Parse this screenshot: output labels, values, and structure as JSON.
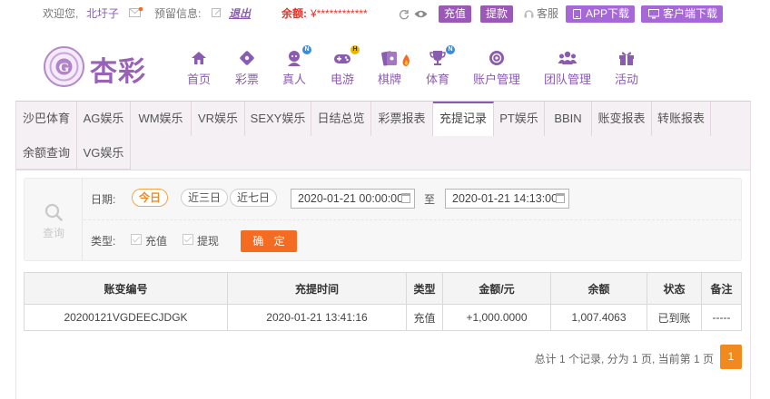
{
  "topbar": {
    "welcome": "欢迎您,",
    "username": "北圩子",
    "reserve_label": "预留信息:",
    "logout": "退出",
    "balance_label": "余额:",
    "balance_value": "¥************",
    "deposit": "充值",
    "withdraw": "提款",
    "service": "客服",
    "app_download": "APP下载",
    "client_download": "客户端下载"
  },
  "brand": {
    "name": "杏彩"
  },
  "nav": [
    {
      "label": "首页",
      "icon": "home-icon"
    },
    {
      "label": "彩票",
      "icon": "lottery-icon"
    },
    {
      "label": "真人",
      "icon": "live-dealer-icon",
      "badge": "N"
    },
    {
      "label": "电游",
      "icon": "gamepad-icon",
      "badge": "H"
    },
    {
      "label": "棋牌",
      "icon": "cards-icon"
    },
    {
      "label": "体育",
      "icon": "trophy-icon",
      "badge": "N"
    },
    {
      "label": "账户管理",
      "icon": "account-icon"
    },
    {
      "label": "团队管理",
      "icon": "team-icon"
    },
    {
      "label": "活动",
      "icon": "gift-icon"
    }
  ],
  "tabs": [
    "沙巴体育",
    "AG娱乐",
    "WM娱乐",
    "VR娱乐",
    "SEXY娱乐",
    "日结总览",
    "彩票报表",
    "充提记录",
    "PT娱乐",
    "BBIN",
    "账变报表",
    "转账报表",
    "余额查询",
    "VG娱乐"
  ],
  "active_tab": "充提记录",
  "filter": {
    "query_label": "查询",
    "date_label": "日期:",
    "quick_ranges": [
      "今日",
      "近三日",
      "近七日"
    ],
    "start_date": "2020-01-21 00:00:00",
    "to_label": "至",
    "end_date": "2020-01-21 14:13:00",
    "type_label": "类型:",
    "types": [
      "充值",
      "提现"
    ],
    "confirm": "确 定"
  },
  "table": {
    "headers": [
      "账变编号",
      "充提时间",
      "类型",
      "金额/元",
      "余额",
      "状态",
      "备注"
    ],
    "rows": [
      [
        "20200121VGDEECJDGK",
        "2020-01-21 13:41:16",
        "充值",
        "+1,000.0000",
        "1,007.4063",
        "已到账",
        "-----"
      ]
    ]
  },
  "pagination": {
    "summary": "总计 1 个记录, 分为 1 页, 当前第 1 页",
    "current_page": "1"
  },
  "colors": {
    "accent": "#8a5bb0",
    "orange": "#f08a1e",
    "red": "#e0352b",
    "green": "#2aa52a"
  }
}
